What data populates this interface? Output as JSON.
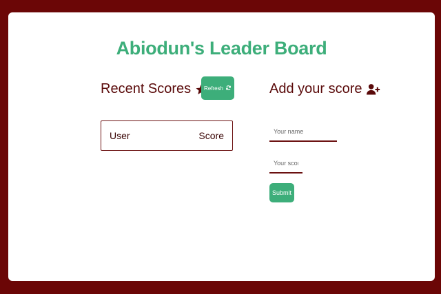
{
  "header": {
    "title": "Abiodun's Leader Board"
  },
  "recent": {
    "title": "Recent Scores",
    "refresh_label": "Refresh",
    "table": {
      "headers": [
        "User",
        "Score"
      ]
    }
  },
  "add": {
    "title": "Add your score",
    "name_placeholder": "Your name",
    "score_placeholder": "Your score",
    "submit_label": "Submit"
  },
  "colors": {
    "accent": "#3dae7a",
    "brand": "#6b0606"
  },
  "icons": [
    "star-icon",
    "refresh-icon",
    "user-plus-icon"
  ]
}
